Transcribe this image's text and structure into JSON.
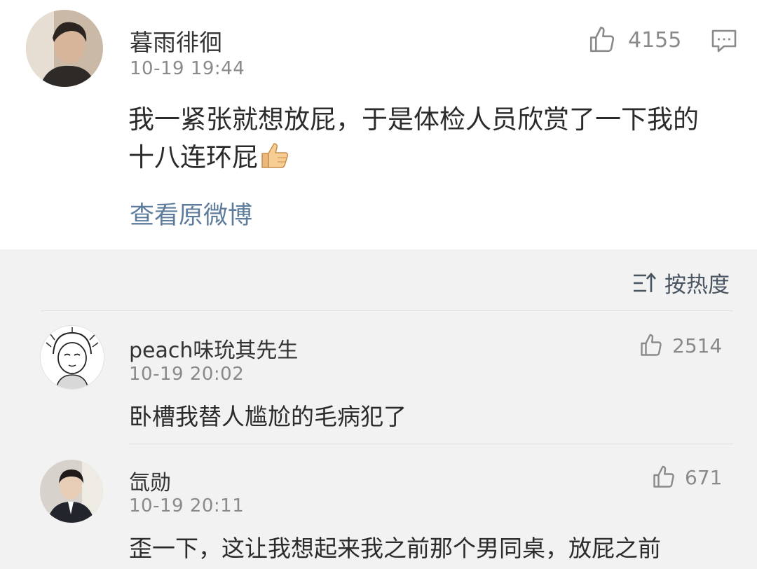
{
  "post": {
    "author": "暮雨徘徊",
    "timestamp": "10-19 19:44",
    "likes": "4155",
    "text_line1": "我一紧张就想放屁，于是体检人员欣赏了一下我的",
    "text_line2": "十八连环屁",
    "view_original": "查看原微博",
    "reply_icon": "comment-icon",
    "like_icon": "thumbs-up-icon"
  },
  "sort": {
    "label": "按热度",
    "icon": "sort-icon"
  },
  "comments": [
    {
      "author": "peach味玧其先生",
      "timestamp": "10-19 20:02",
      "likes": "2514",
      "text": "卧槽我替人尴尬的毛病犯了"
    },
    {
      "author": "氙勋",
      "timestamp": "10-19 20:11",
      "likes": "671",
      "text": "歪一下，这让我想起来我之前那个男同桌，放屁之前"
    }
  ],
  "colors": {
    "link": "#5d7c9c",
    "meta": "#8a8a8a",
    "background": "#f2f2f2"
  }
}
